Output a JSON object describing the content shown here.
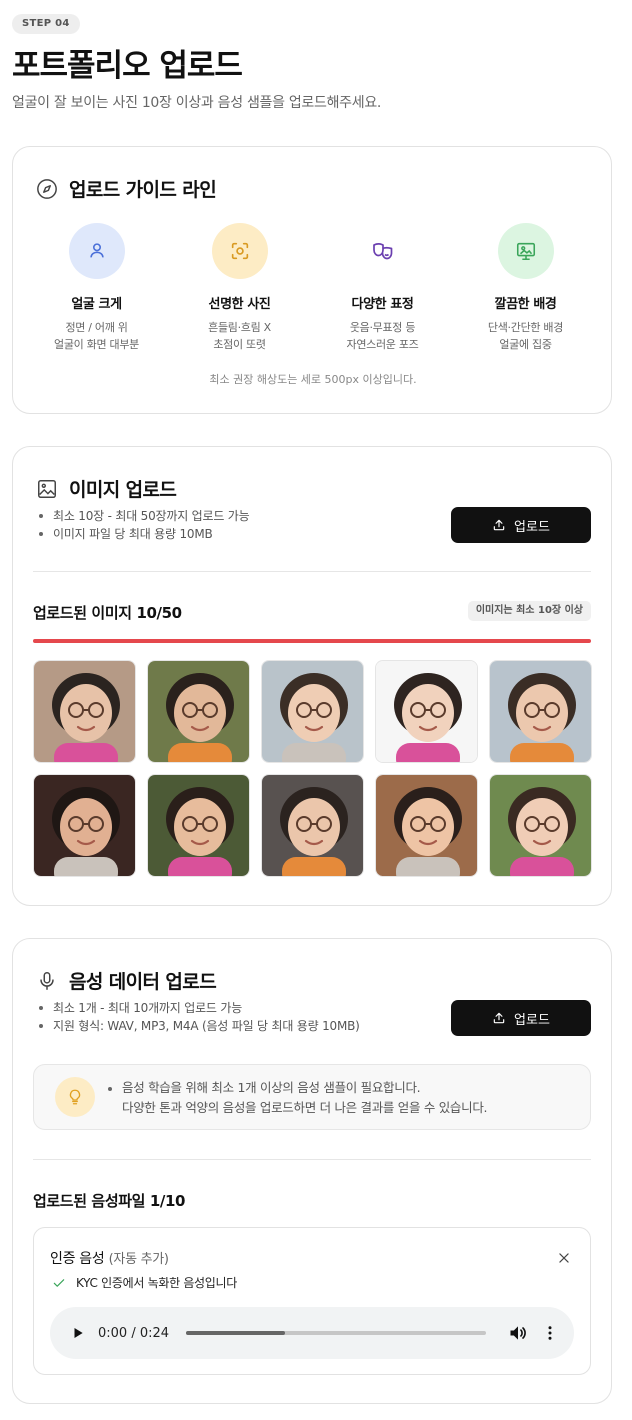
{
  "header": {
    "step": "STEP 04",
    "title": "포트폴리오 업로드",
    "subtitle": "얼굴이 잘 보이는 사진 10장 이상과 음성 샘플을 업로드해주세요."
  },
  "guide": {
    "title": "업로드 가이드 라인",
    "icon": "compass-icon",
    "items": [
      {
        "name": "얼굴 크게",
        "line1": "정면 / 어깨 위",
        "line2": "얼굴이 화면 대부분",
        "icon": "user-icon",
        "color": "#dfe8fb",
        "icon_color": "#4a6fd8"
      },
      {
        "name": "선명한 사진",
        "line1": "흔들림·흐림 X",
        "line2": "초점이 또렷",
        "icon": "focus-icon",
        "color": "#fdecc5",
        "icon_color": "#d99a22"
      },
      {
        "name": "다양한 표정",
        "line1": "웃음·무표정 등",
        "line2": "자연스러운 포즈",
        "icon": "masks-icon",
        "color": "#ffffff",
        "icon_color": "#6b3fb0"
      },
      {
        "name": "깔끔한 배경",
        "line1": "단색·간단한 배경",
        "line2": "얼굴에 집중",
        "icon": "monitor-image-icon",
        "color": "#dcf5e1",
        "icon_color": "#3aa55a"
      }
    ],
    "note": "최소 권장 해상도는 세로 500px 이상입니다."
  },
  "images": {
    "title": "이미지 업로드",
    "icon": "image-icon",
    "bullets": [
      "최소 10장 - 최대 50장까지 업로드 가능",
      "이미지 파일 당 최대 용량 10MB"
    ],
    "upload_label": "업로드",
    "uploaded_title": "업로드된 이미지 10/50",
    "min_badge": "이미지는 최소 10장 이상",
    "progress_percent": 100,
    "progress_color": "#e5484d",
    "thumbs": [
      {
        "bg": "#b59a86",
        "skin": "#e7c2a8",
        "hair": "#2b2420"
      },
      {
        "bg": "#6f7a4a",
        "skin": "#e2b899",
        "hair": "#2a211c"
      },
      {
        "bg": "#b9c3ca",
        "skin": "#efcdb4",
        "hair": "#3b2e26"
      },
      {
        "bg": "#f6f6f6",
        "skin": "#f1d2bd",
        "hair": "#2e2420"
      },
      {
        "bg": "#b8c3cc",
        "skin": "#ecc8ae",
        "hair": "#3a2d25"
      },
      {
        "bg": "#3a2622",
        "skin": "#e1b092",
        "hair": "#1f1714"
      },
      {
        "bg": "#4c5a36",
        "skin": "#e7bc9c",
        "hair": "#2a1f1a"
      },
      {
        "bg": "#585250",
        "skin": "#ebc6ab",
        "hair": "#2b231f"
      },
      {
        "bg": "#9c6b4a",
        "skin": "#eec4a5",
        "hair": "#2a1f1b"
      },
      {
        "bg": "#6f8a4f",
        "skin": "#f0cdb6",
        "hair": "#3a2a22"
      }
    ]
  },
  "voice": {
    "title": "음성 데이터 업로드",
    "icon": "microphone-icon",
    "bullets": [
      "최소 1개 - 최대 10개까지 업로드 가능",
      "지원 형식: WAV, MP3, M4A (음성 파일 당 최대 용량 10MB)"
    ],
    "upload_label": "업로드",
    "tip_line1": "음성 학습을 위해 최소 1개 이상의 음성 샘플이 필요합니다.",
    "tip_line2": "다양한 톤과 억양의 음성을 업로드하면 더 나은 결과를 얻을 수 있습니다.",
    "uploaded_title": "업로드된 음성파일 1/10",
    "file": {
      "title": "인증 음성",
      "sub": "(자동 추가)",
      "kyc": "KYC 인증에서 녹화한 음성입니다",
      "time": "0:00 / 0:24",
      "progress_fraction": 0.33
    }
  }
}
